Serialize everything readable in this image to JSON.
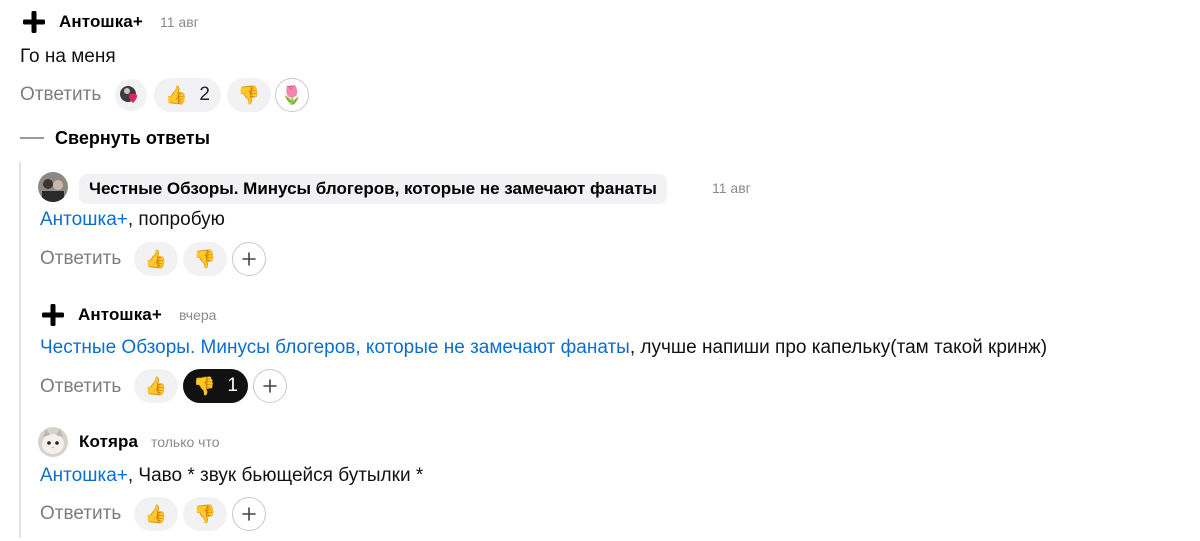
{
  "comments": [
    {
      "author": "Антошка+",
      "time": "11 авг",
      "text": "Го на меня",
      "reply_label": "Ответить",
      "likes": "2"
    },
    {
      "author": "Честные Обзоры. Минусы блогеров, которые не замечают фанаты",
      "time": "11 авг",
      "mention": "Антошка+",
      "text": ", попробую",
      "reply_label": "Ответить"
    },
    {
      "author": "Антошка+",
      "time": "вчера",
      "mention": "Честные Обзоры. Минусы блогеров, которые не замечают фанаты",
      "text": ", лучше напиши про капельку(там такой кринж)",
      "reply_label": "Ответить",
      "dislikes": "1"
    },
    {
      "author": "Котяра",
      "time": "только что",
      "mention": "Антошка+",
      "text": ", Чаво * звук бьющейся бутылки *",
      "reply_label": "Ответить"
    }
  ],
  "thread": {
    "collapse_label": "Свернуть ответы"
  },
  "icons": {
    "like": "thumbs-up-icon",
    "dislike": "thumbs-down-icon",
    "add_reaction": "plus-icon"
  },
  "colors": {
    "mention": "#0a6ed1",
    "pill": "#f2f2f4",
    "dark_pill": "#111111"
  }
}
